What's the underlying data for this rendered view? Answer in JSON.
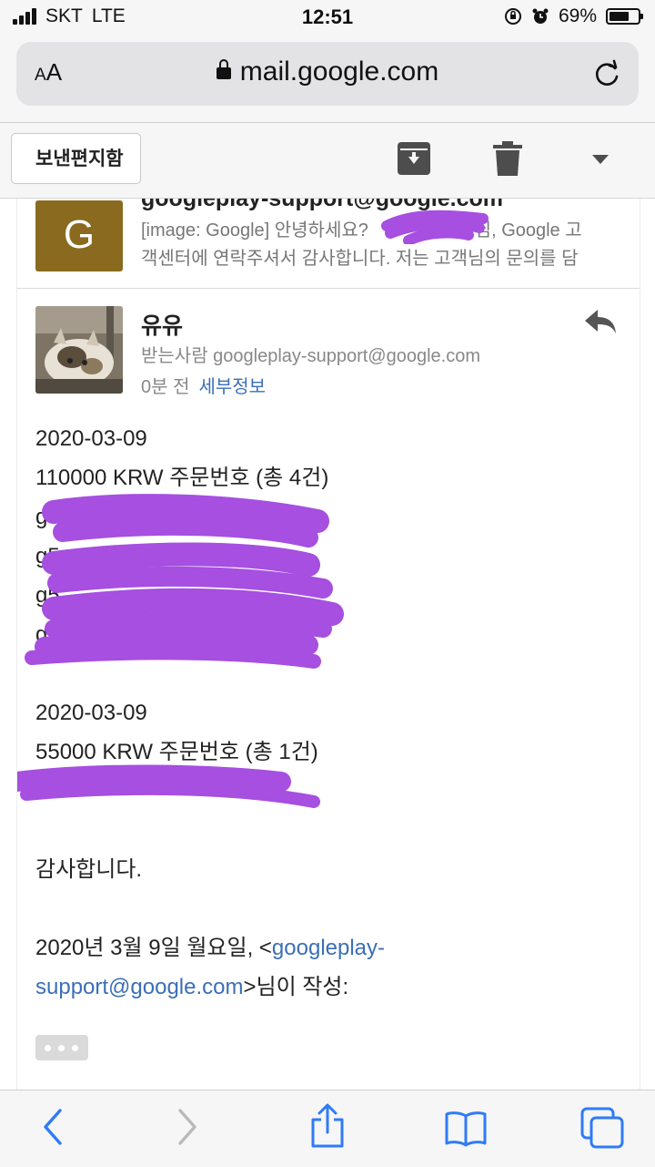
{
  "status_bar": {
    "carrier": "SKT",
    "network": "LTE",
    "time": "12:51",
    "battery_percent": "69%",
    "battery_level": 0.69
  },
  "browser": {
    "text_size_label": "AA",
    "url": "mail.google.com",
    "lock_icon": "lock-icon",
    "reload_icon": "reload-icon"
  },
  "gmail_toolbar": {
    "back_label": "보낸편지함",
    "archive_icon": "archive-icon",
    "delete_icon": "trash-icon",
    "menu_icon": "chevron-down-icon"
  },
  "previous_message": {
    "avatar_letter": "G",
    "avatar_color": "#8a6a1f",
    "from": "googleplay-support@google.com",
    "snippet_line1_a": "[image: Google] 안녕하세요?",
    "snippet_line1_b": "고객님, Google 고",
    "snippet_line2": "객센터에 연락주셔서 감사합니다. 저는 고객님의 문의를 담"
  },
  "current_message": {
    "sender": "유유",
    "recipient_label": "받는사람",
    "recipient": "googleplay-support@google.com",
    "time": "0분 전",
    "details_label": "세부정보",
    "reply_icon": "reply-icon",
    "body": {
      "date1": "2020-03-09",
      "order1": "110000 KRW 주문번호 (총 4건)",
      "order1_ids": [
        "g0",
        "g5",
        "g5",
        "g3"
      ],
      "date2": "2020-03-09",
      "order2": "55000 KRW 주문번호 (총 1건)",
      "thanks": "감사합니다.",
      "quote_prefix": "2020년 3월 9일 월요일, <",
      "quote_email_a": "googleplay-",
      "quote_email_b": "support@google.com",
      "quote_suffix": ">님이 작성:"
    },
    "more_icon": "ellipsis-icon"
  },
  "bottom_bar": {
    "icons": [
      "back-icon",
      "forward-icon",
      "share-icon",
      "bookmarks-icon",
      "tabs-icon"
    ]
  },
  "colors": {
    "link": "#3b6fb6",
    "redaction": "#a64fe0",
    "toolbar_bg": "#f6f6f6",
    "ios_blue": "#2f7bf6"
  }
}
